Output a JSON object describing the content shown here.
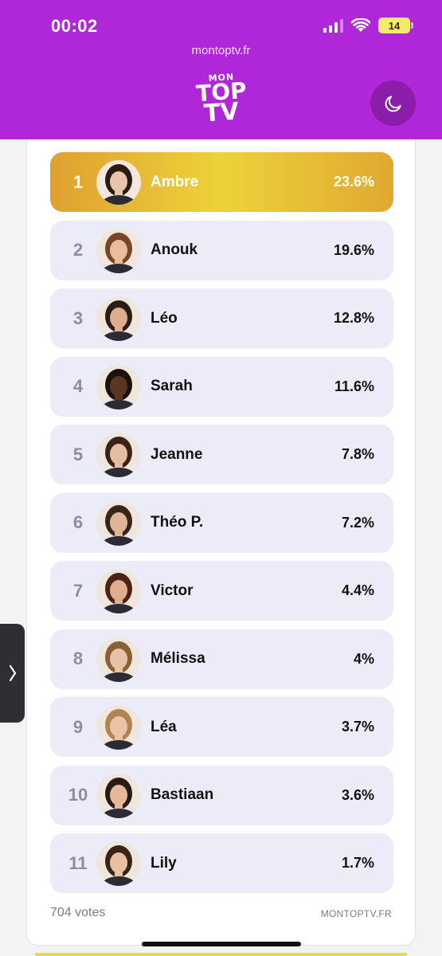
{
  "status_bar": {
    "time": "00:02",
    "battery": "14"
  },
  "browser": {
    "url": "montoptv.fr"
  },
  "logo": {
    "line1": "MON",
    "line2": "TOP",
    "line3": "TV"
  },
  "theme_toggle": {
    "icon": "moon-icon"
  },
  "ranking": [
    {
      "rank": "1",
      "name": "Ambre",
      "percent": "23.6%",
      "value": 23.6,
      "skin": "#e8c4ad",
      "hair": "#2a1a14"
    },
    {
      "rank": "2",
      "name": "Anouk",
      "percent": "19.6%",
      "value": 19.6,
      "skin": "#e9bd9d",
      "hair": "#7a4526"
    },
    {
      "rank": "3",
      "name": "Léo",
      "percent": "12.8%",
      "value": 12.8,
      "skin": "#dcae8f",
      "hair": "#2b1d16"
    },
    {
      "rank": "4",
      "name": "Sarah",
      "percent": "11.6%",
      "value": 11.6,
      "skin": "#5a3524",
      "hair": "#1c120c"
    },
    {
      "rank": "5",
      "name": "Jeanne",
      "percent": "7.8%",
      "value": 7.8,
      "skin": "#e6bca2",
      "hair": "#3a2218"
    },
    {
      "rank": "6",
      "name": "Théo P.",
      "percent": "7.2%",
      "value": 7.2,
      "skin": "#e0b497",
      "hair": "#3a2418"
    },
    {
      "rank": "7",
      "name": "Victor",
      "percent": "4.4%",
      "value": 4.4,
      "skin": "#deae8e",
      "hair": "#4a2516"
    },
    {
      "rank": "8",
      "name": "Mélissa",
      "percent": "4%",
      "value": 4,
      "skin": "#e8c2a6",
      "hair": "#8a6038"
    },
    {
      "rank": "9",
      "name": "Léa",
      "percent": "3.7%",
      "value": 3.7,
      "skin": "#eac3a8",
      "hair": "#b08450"
    },
    {
      "rank": "10",
      "name": "Bastiaan",
      "percent": "3.6%",
      "value": 3.6,
      "skin": "#e4b89b",
      "hair": "#2a1a12"
    },
    {
      "rank": "11",
      "name": "Lily",
      "percent": "1.7%",
      "value": 1.7,
      "skin": "#e8c0a4",
      "hair": "#3a2418"
    }
  ],
  "footer": {
    "votes": "704 votes",
    "source": "MONTOPTV.FR"
  },
  "colors": {
    "header": "#b026d9",
    "row": "#ececf9",
    "gold": "#ecd33a"
  }
}
